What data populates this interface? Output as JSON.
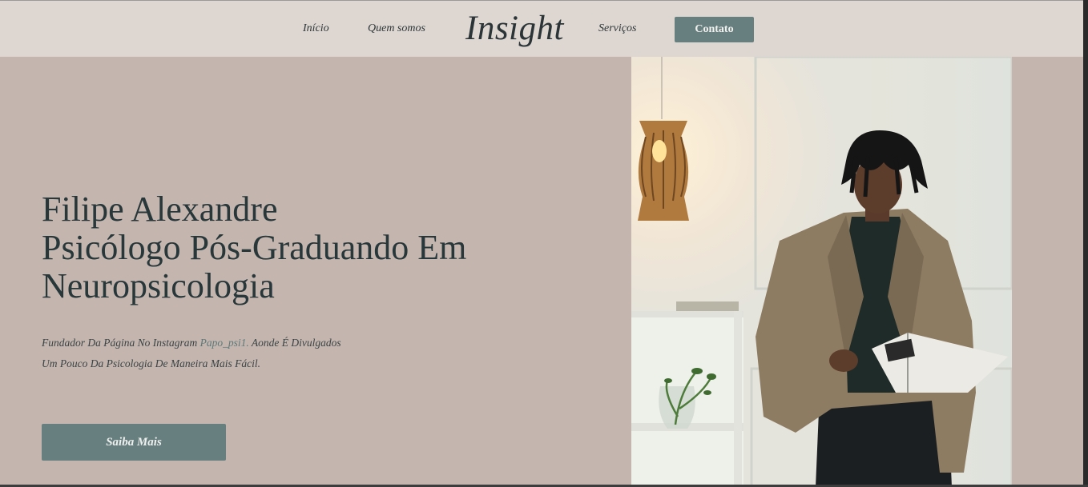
{
  "nav": {
    "items": [
      {
        "label": "Início"
      },
      {
        "label": "Quem somos"
      },
      {
        "label": "Serviços"
      }
    ],
    "logo": "Insight",
    "contact_label": "Contato"
  },
  "hero": {
    "title_lines": [
      "Filipe Alexandre",
      "Psicólogo Pós-Graduando Em",
      "Neuropsicologia"
    ],
    "text_line1_before": "Fundador Da Página No Instagram ",
    "instagram_handle": "Papo_psi1.",
    "text_line1_after": " Aonde É Divulgados",
    "text_line2": "Um Pouco Da Psicologia De Maneira Mais Fácil.",
    "cta_label": "Saiba Mais"
  },
  "colors": {
    "background": "#c4b5ae",
    "header": "#ddd6d1",
    "accent": "#677f7f",
    "text": "#2b3436"
  }
}
